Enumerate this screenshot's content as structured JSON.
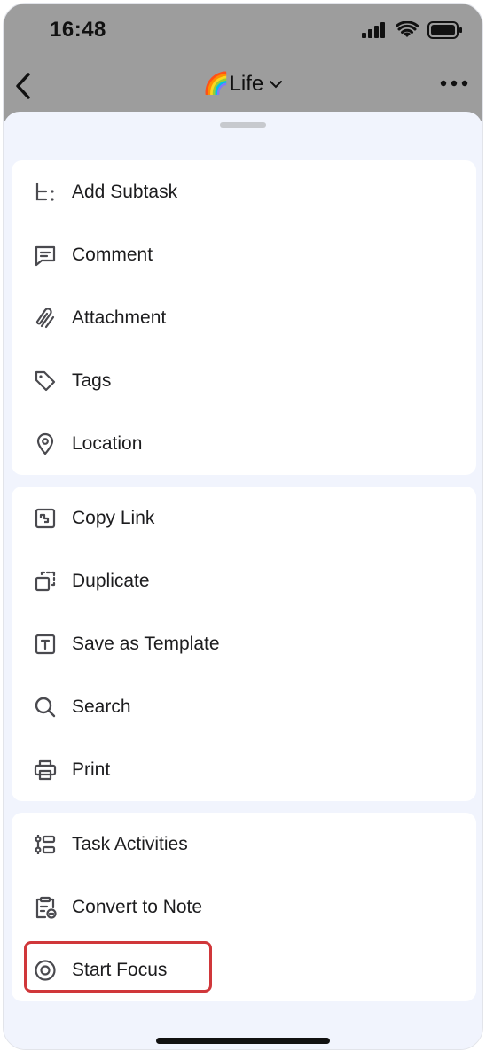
{
  "status_bar": {
    "time": "16:48"
  },
  "nav": {
    "title": "🌈Life"
  },
  "menu_groups": [
    {
      "items": [
        {
          "label": "Add Subtask",
          "icon": "subtask-icon"
        },
        {
          "label": "Comment",
          "icon": "comment-icon"
        },
        {
          "label": "Attachment",
          "icon": "paperclip-icon"
        },
        {
          "label": "Tags",
          "icon": "tag-icon"
        },
        {
          "label": "Location",
          "icon": "location-pin-icon"
        }
      ]
    },
    {
      "items": [
        {
          "label": "Copy Link",
          "icon": "link-icon"
        },
        {
          "label": "Duplicate",
          "icon": "duplicate-icon"
        },
        {
          "label": "Save as Template",
          "icon": "template-icon"
        },
        {
          "label": "Search",
          "icon": "search-icon"
        },
        {
          "label": "Print",
          "icon": "printer-icon"
        }
      ]
    },
    {
      "items": [
        {
          "label": "Task Activities",
          "icon": "activities-icon"
        },
        {
          "label": "Convert to Note",
          "icon": "convert-note-icon"
        },
        {
          "label": "Start Focus",
          "icon": "focus-icon",
          "highlighted": true
        }
      ]
    }
  ],
  "colors": {
    "highlight": "#d0373a",
    "sheet_bg": "#f1f4fd",
    "icon": "#4a4a4f"
  }
}
